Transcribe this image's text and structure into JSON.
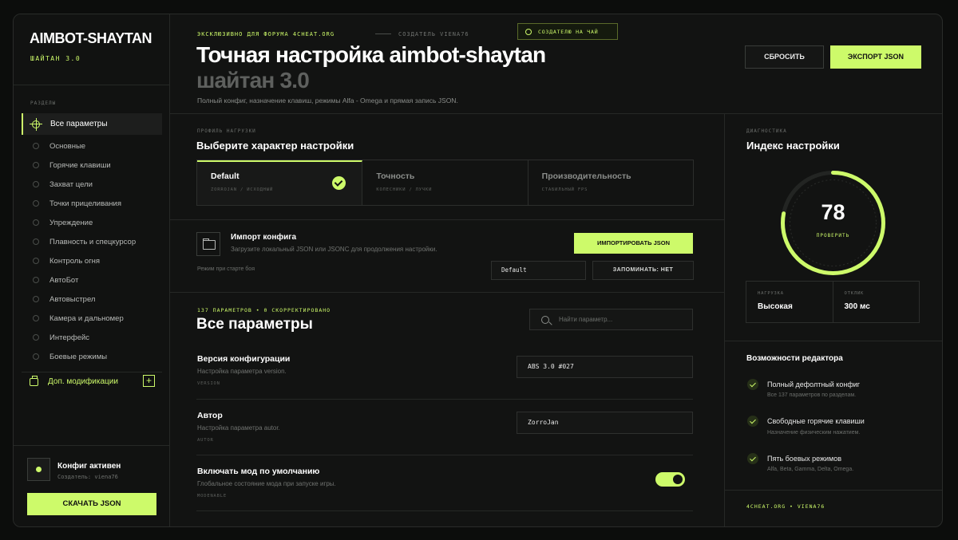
{
  "brand": {
    "title": "AIMBOT-SHAYTAN",
    "version": "ШАЙТАН 3.0"
  },
  "sidebar": {
    "section_label": "РАЗДЕЛЫ",
    "items": [
      {
        "label": "Все параметры"
      },
      {
        "label": "Основные"
      },
      {
        "label": "Горячие клавиши"
      },
      {
        "label": "Захват цели"
      },
      {
        "label": "Точки прицеливания"
      },
      {
        "label": "Упреждение"
      },
      {
        "label": "Плавность и спецкурсор"
      },
      {
        "label": "Контроль огня"
      },
      {
        "label": "АвтоБот"
      },
      {
        "label": "Автовыстрел"
      },
      {
        "label": "Камера и дальномер"
      },
      {
        "label": "Интерфейс"
      },
      {
        "label": "Боевые режимы"
      }
    ],
    "mods_label": "Доп. модификации",
    "active_title": "Конфиг активен",
    "active_sub": "Создатель: viena76",
    "download_label": "СКАЧАТЬ JSON"
  },
  "header": {
    "exclusive": "ЭКСКЛЮЗИВНО ДЛЯ ФОРУМА 4CHEAT.ORG",
    "creator": "СОЗДАТЕЛЬ VIENA76",
    "tea_label": "СОЗДАТЕЛЮ НА ЧАЙ",
    "title": "Точная настройка aimbot-shaytan",
    "subtitle": "шайтан 3.0",
    "description": "Полный конфиг, назначение клавиш, режимы Alfa - Omega и прямая запись JSON.",
    "reset_label": "СБРОСИТЬ",
    "export_label": "ЭКСПОРТ JSON"
  },
  "profile": {
    "eyebrow": "ПРОФИЛЬ НАГРУЗКИ",
    "title": "Выберите характер настройки",
    "options": [
      {
        "title": "Default",
        "sub": "ZORROJAN / ИСХОДНЫЙ"
      },
      {
        "title": "Точность",
        "sub": "КОЛЕСНИКИ / ЛУЧКИ"
      },
      {
        "title": "Производительность",
        "sub": "СТАБИЛЬНЫЙ FPS"
      }
    ]
  },
  "import": {
    "title": "Импорт конфига",
    "description": "Загрузите локальный JSON или JSONC для продолжения настройки.",
    "button": "ИМПОРТИРОВАТЬ JSON",
    "mode_label": "Режим при старте боя",
    "mode_value": "Default",
    "remember": "ЗАПОМИНАТЬ: НЕТ"
  },
  "params": {
    "count": "137 ПАРАМЕТРОВ • 0 СКОРРЕКТИРОВАНО",
    "title": "Все параметры",
    "search_placeholder": "Найти параметр...",
    "rows": [
      {
        "title": "Версия конфигурации",
        "desc": "Настройка параметра version.",
        "key": "VERSION",
        "value": "ABS 3.0 #027"
      },
      {
        "title": "Автор",
        "desc": "Настройка параметра autor.",
        "key": "AUTOR",
        "value": "ZorroJan"
      },
      {
        "title": "Включать мод по умолчанию",
        "desc": "Глобальное состояние мода при запуске игры.",
        "key": "MODENABLE"
      }
    ]
  },
  "diagnostics": {
    "eyebrow": "ДИАГНОСТИКА",
    "title": "Индекс настройки",
    "score": "78",
    "score_fraction": 0.78,
    "verify_label": "ПРОВЕРИТЬ",
    "load_label": "НАГРУЗКА",
    "load_value": "Высокая",
    "latency_label": "ОТКЛИК",
    "latency_value": "300 мс"
  },
  "features": {
    "title": "Возможности редактора",
    "items": [
      {
        "title": "Полный дефолтный конфиг",
        "sub": "Все 137 параметров по разделам."
      },
      {
        "title": "Свободные горячие клавиши",
        "sub": "Назначение физическим нажатием."
      },
      {
        "title": "Пять боевых режимов",
        "sub": "Alfa, Beta, Gamma, Delta, Omega."
      }
    ],
    "footer": "4CHEAT.ORG • VIENA76"
  },
  "colors": {
    "accent": "#cdfa6a",
    "background": "#121312"
  }
}
